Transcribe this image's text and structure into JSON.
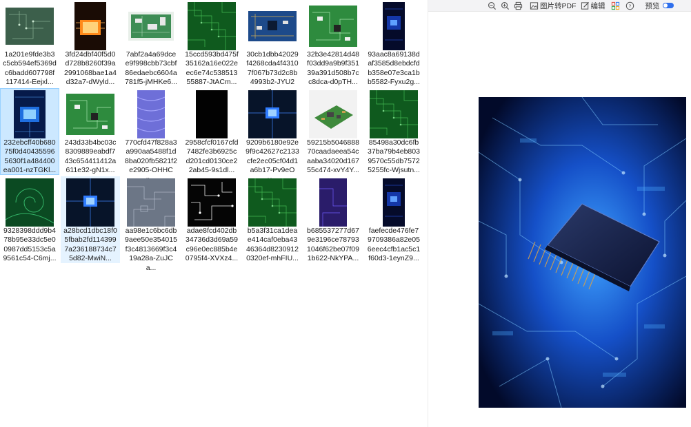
{
  "files": [
    {
      "name": "1a201e9fde3b3c5cb594ef5369dc6badd607798f117414-Eejxl...",
      "thumb": "pcb-dark-green"
    },
    {
      "name": "3fd24dbf40f5d0d728b8260f39a2991068bae1a4d32a7-dWyld...",
      "thumb": "chip-orange-glow"
    },
    {
      "name": "7abf2a4a69dcee9f998cbb73cbf86edaebc6604a781f5-jMHKe6...",
      "thumb": "pcb-light-green"
    },
    {
      "name": "15ccd593bd475f35162a16e022eec6e74c53851355887-JtACm...",
      "thumb": "pcb-green-texture"
    },
    {
      "name": "30cb1dbb42029f4268cda4f43107f067b73d2c8b4993b2-JYU27...",
      "thumb": "pcb-blue-board"
    },
    {
      "name": "32b3e42814d48f03dd9a9b9f35139a391d508b7cc8dca-d0pTH...",
      "thumb": "pcb-green-board"
    },
    {
      "name": "93aac8a69138daf3585d8ebdcfdb358e07e3ca1bb5582-Fyxu2g...",
      "thumb": "phone-dark-blue"
    },
    {
      "name": "232ebcff40b68075f0d404355965630f1a484400ea001-nzTGKl...",
      "thumb": "chip-blue-glow"
    },
    {
      "name": "243d33b4bc03c8309889eabdf743c654411412a611e32-gN1x...",
      "thumb": "pcb-green-board"
    },
    {
      "name": "770cfd47f828a3a990aa5488f1d8ba020fb5821f2e2905-OHHCn...",
      "thumb": "purple-pattern"
    },
    {
      "name": "2958cfcf0167cfd7482fe3b6925cd201cd0130ce22ab45-9s1dl...",
      "thumb": "black"
    },
    {
      "name": "9209b6180e92e9f9c42627c2133cfe2ec05cf04d1a6b17-Pv9eOy...",
      "thumb": "chip-blue-dark"
    },
    {
      "name": "59215b504688870caadaeea54caaba34020d16755c474-xvY4Y...",
      "thumb": "pcb-3d-board"
    },
    {
      "name": "85498a30dc6fb37ba79b4eb8039570c55db75725255fc-Wjsutn...",
      "thumb": "pcb-green-texture"
    },
    {
      "name": "9328398ddd9b478b95e33dc5e00987dd5153c5a9561c54-C6mj...",
      "thumb": "green-swirl"
    },
    {
      "name": "a28bcd1dbc18f05fbab2fd1143997a236188734c75d82-MwiN...",
      "thumb": "chip-blue-dark"
    },
    {
      "name": "aa98e1c6bc6db9aee50e354015f3c4813669f3c419a28a-ZuJCa...",
      "thumb": "gray-pattern"
    },
    {
      "name": "adae8fcd402db34736d3d69a59c96e0ec885b4e0795f4-XVXz4...",
      "thumb": "circuit-black-white"
    },
    {
      "name": "b5a3f31ca1deae414caf0eba4346364d82309120320ef-mhFIU...",
      "thumb": "pcb-green-texture"
    },
    {
      "name": "b685537277d679e3196ce787931046f62be07f091b622-NkYPA...",
      "thumb": "purple-dark"
    },
    {
      "name": "faefecde476fe79709386a82e056eec4cfb1ac5c1f60d3-1eynZ9...",
      "thumb": "phone-dark-blue"
    }
  ],
  "selected_index": 7,
  "hover_index": 15,
  "toolbar": {
    "zoom_out_icon": "zoom-out-icon",
    "zoom_in_icon": "zoom-in-icon",
    "print_icon": "printer-icon",
    "pdf_label": "图片转PDF",
    "edit_label": "编辑",
    "apps_icon": "apps-icon",
    "help_icon": "help-icon",
    "preview_label": "预览",
    "preview_on": true
  },
  "preview": {
    "thumb": "chip-blue-large"
  },
  "colors": {
    "selected_bg": "#cce8ff",
    "selected_border": "#99d1ff",
    "hover_bg": "#e5f3ff",
    "toggle": "#2f6fed"
  }
}
